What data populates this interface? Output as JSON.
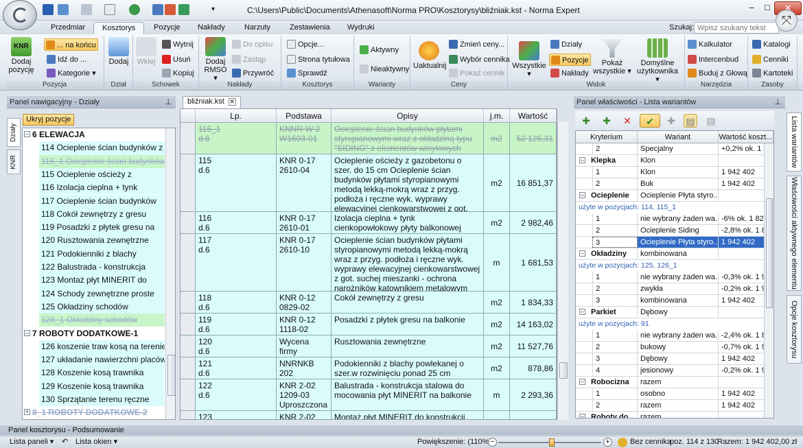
{
  "window": {
    "title": "C:\\Users\\Public\\Documents\\Athenasoft\\Norma PRO\\Kosztorysy\\bliźniak.kst - Norma Expert",
    "minimize": "–",
    "maximize": "□",
    "close": "✕"
  },
  "tabs": [
    "Przedmiar",
    "Kosztorys",
    "Pozycje",
    "Nakłady",
    "Narzuty",
    "Zestawienia",
    "Wydruki"
  ],
  "active_tab": "Kosztorys",
  "search": {
    "label": "Szukaj:",
    "placeholder": "Wpisz szukany tekst"
  },
  "ribbon": {
    "groups": [
      "Pozycja",
      "Dział",
      "Schowek",
      "Nakłady",
      "Kosztorys",
      "Warianty",
      "Ceny",
      "Widok",
      "Narzędzia",
      "Zasoby"
    ],
    "add_position": "Dodaj pozycję",
    "at_end": "... na końcu",
    "go_to": "Idź do ...",
    "categories": "Kategorie",
    "add": "Dodaj",
    "paste": "Wklej",
    "cut": "Wytnij",
    "delete": "Usuń",
    "copy": "Kopiuj",
    "add_rmso": "Dodaj RMSO",
    "to_opis": "Do opisu",
    "replace": "Zastąp",
    "recalc": "Przywróć",
    "options": "Opcje...",
    "title_page": "Strona tytułowa",
    "check": "Sprawdź",
    "active": "Aktywny",
    "inactive": "Nieaktywny",
    "update": "Uaktualnij",
    "change_prices": "Zmień ceny...",
    "choose_pricelist": "Wybór cennika",
    "show_pricelist": "Pokaż cennik",
    "all": "Wszystkie",
    "sections": "Działy",
    "positions": "Pozycje",
    "outlays": "Nakłady",
    "show_all": "Pokaż wszystkie",
    "user_default": "Domyślne użytkownika",
    "calculator": "Kalkulator",
    "intercenbud": "Intercenbud",
    "build_from_glowa": "Buduj z Głową",
    "catalogs": "Katalogi",
    "pricelists": "Cenniki",
    "cards": "Kartoteki"
  },
  "left_panel": {
    "title": "Panel nawigacyjny - Działy",
    "hide_button": "Ukryj pozycje",
    "vtabs": [
      "Działy",
      "KNR"
    ],
    "rows": [
      {
        "type": "hdr",
        "text": "6 ELEWACJA",
        "exp": "–"
      },
      {
        "type": "leaf",
        "text": "114 Ocieplenie ścian budynków z"
      },
      {
        "type": "strike",
        "text": "115_1 Ocieplenie ścian budynków"
      },
      {
        "type": "leaf",
        "text": "115 Ocieplenie ościeży z"
      },
      {
        "type": "leaf",
        "text": "116 Izolacja cieplna + tynk"
      },
      {
        "type": "leaf",
        "text": "117 Ocieplenie ścian budynków"
      },
      {
        "type": "leaf",
        "text": "118 Cokół zewnętrzy z gresu"
      },
      {
        "type": "leaf",
        "text": "119 Posadzki z płytek gresu na"
      },
      {
        "type": "leaf",
        "text": "120 Rusztowania zewnętrzne"
      },
      {
        "type": "leaf",
        "text": "121 Podokienniki z blachy"
      },
      {
        "type": "leaf",
        "text": "122 Balustrada - konstrukcja"
      },
      {
        "type": "leaf",
        "text": "123 Montaż płyt MINERIT do"
      },
      {
        "type": "leaf",
        "text": "124 Schody zewnętrzne proste"
      },
      {
        "type": "leaf",
        "text": "125 Okładziny schodów"
      },
      {
        "type": "strike",
        "text": "126_1 Okładziny schodów"
      },
      {
        "type": "hdr",
        "text": "7 ROBOTY DODATKOWE-1",
        "exp": "–"
      },
      {
        "type": "leaf",
        "text": "126 koszenie traw kosą na terenie"
      },
      {
        "type": "leaf",
        "text": "127 układanie nawierzchni placów"
      },
      {
        "type": "leaf",
        "text": "128 Koszenie kosą trawnika"
      },
      {
        "type": "leaf",
        "text": "129 Koszenie kosą trawnika"
      },
      {
        "type": "leaf",
        "text": "130 Sprzątanie terenu ręczne"
      },
      {
        "type": "strikebold",
        "text": "8_1 ROBOTY DODATKOWE-2",
        "exp": "+"
      }
    ]
  },
  "document": {
    "tab": "bliźniak.kst",
    "columns": [
      "Lp.",
      "Podstawa",
      "Opisy",
      "j.m.",
      "Wartość"
    ],
    "rows": [
      {
        "lp": "115_1\nd.6",
        "base": "KNNR-W 2\nW1603-01",
        "desc": "Ocieplenie ścian budynków płytami styropianowymi wraz z okładziną typu \"SIDING\" z elementów winylowych",
        "unit": "m2",
        "value": "52 126,31",
        "green": true
      },
      {
        "lp": "115\nd.6",
        "base": "KNR 0-17\n2610-04",
        "desc": "Ocieplenie ościeży z gazobetonu o szer. do 15 cm Ocieplenie ścian budynków płytami styropianowymi metodą lekką-mokrą wraz z przyg. podłoża i ręczne wyk. wyprawy elewacyjnej cienkowarstwowej z got. suchej mieszanki",
        "unit": "m2",
        "value": "16 851,37"
      },
      {
        "lp": "116\nd.6",
        "base": "KNR 0-17\n2610-01",
        "desc": "Izolacja cieplna + tynk cienkopowłokowy płyty balkonowej",
        "unit": "m2",
        "value": "2 982,46"
      },
      {
        "lp": "117\nd.6",
        "base": "KNR 0-17\n2610-10",
        "desc": "Ocieplenie ścian budynków płytami styropianowymi metodą lekką-mokrą wraz z przyg. podłoża i ręczne wyk. wyprawy elewacyjnej cienkowarstwowej z got. suchej mieszanki - ochrona narożników kątownikiem metalowym",
        "unit": "m",
        "value": "1 681,53"
      },
      {
        "lp": "118\nd.6",
        "base": "KNR 0-12\n0829-02",
        "desc": "Cokół zewnętrzy z gresu",
        "unit": "m2",
        "value": "1 834,33"
      },
      {
        "lp": "119\nd.6",
        "base": "KNR 0-12\n1118-02",
        "desc": "Posadzki z płytek gresu na balkonie",
        "unit": "m2",
        "value": "14 163,02"
      },
      {
        "lp": "120\nd.6",
        "base": "Wycena\nfirmy",
        "desc": "Rusztowania zewnętrzne",
        "unit": "m2",
        "value": "11 527,76"
      },
      {
        "lp": "121\nd.6",
        "base": "NNRNKB 202\n0541-02",
        "desc": "Podokienniki z blachy powlekanej o szer.w rozwinięciu ponad 25 cm",
        "unit": "m2",
        "value": "878,86"
      },
      {
        "lp": "122\nd.6",
        "base": "KNR 2-02\n1209-03\nUproszczona",
        "desc": "Balustrada - konstrukcja stalowa do mocowania płyt MINERIT na balkonie",
        "unit": "m",
        "value": "2 293,36"
      },
      {
        "lp": "123",
        "base": "KNR 2-02",
        "desc": "Montaż płyt MINERIT do konstrukcji",
        "unit": "",
        "value": ""
      }
    ]
  },
  "right_panel": {
    "title": "Panel właściwości - Lista wariantów",
    "columns": [
      "Kryterium",
      "Wariant",
      "Wartość koszt..."
    ],
    "vtabs": [
      "Lista wariantów",
      "Właściwości aktywnego elementu",
      "Opcje kosztorysu"
    ],
    "rows": [
      {
        "t": "opt",
        "n": "2",
        "v": "Specjalny",
        "w": "+0,2% ok. 1 ..."
      },
      {
        "t": "crit",
        "n": "Klepka",
        "v": "Klon",
        "w": ""
      },
      {
        "t": "opt",
        "n": "1",
        "v": "Klon",
        "w": "1 942 402"
      },
      {
        "t": "opt",
        "n": "2",
        "v": "Buk",
        "w": "1 942 402"
      },
      {
        "t": "crit",
        "n": "Ocieplenie",
        "v": "Ocieplenie Płyta styro...",
        "w": ""
      },
      {
        "t": "used",
        "n": "użyte w pozycjach: 114, 115_1"
      },
      {
        "t": "opt",
        "n": "1",
        "v": "nie wybrany żaden wa...",
        "w": "-6% ok. 1 825..."
      },
      {
        "t": "opt",
        "n": "2",
        "v": "Ocieplenie Siding",
        "w": "-2,8% ok. 1 8..."
      },
      {
        "t": "sel",
        "n": "3",
        "v": "Ocieplenie Płyta styro...",
        "w": "1 942 402"
      },
      {
        "t": "crit",
        "n": "Okładziny",
        "v": "kombinowana",
        "w": ""
      },
      {
        "t": "used",
        "n": "użyte w pozycjach: 125, 126_1"
      },
      {
        "t": "opt",
        "n": "1",
        "v": "nie wybrany żaden wa...",
        "w": "-0,3% ok. 1 9..."
      },
      {
        "t": "opt",
        "n": "2",
        "v": "zwykła",
        "w": "-0,2% ok. 1 9..."
      },
      {
        "t": "opt",
        "n": "3",
        "v": "kombinowana",
        "w": "1 942 402"
      },
      {
        "t": "crit",
        "n": "Parkiet",
        "v": "Dębowy",
        "w": ""
      },
      {
        "t": "used",
        "n": "użyte w pozycjach: 91"
      },
      {
        "t": "opt",
        "n": "1",
        "v": "nie wybrany żaden wa...",
        "w": "-2,4% ok. 1 8..."
      },
      {
        "t": "opt",
        "n": "2",
        "v": "bukowy",
        "w": "-0,7% ok. 1 9..."
      },
      {
        "t": "opt",
        "n": "3",
        "v": "Dębowy",
        "w": "1 942 402"
      },
      {
        "t": "opt",
        "n": "4",
        "v": "jesionowy",
        "w": "-0,2% ok. 1 9..."
      },
      {
        "t": "crit",
        "n": "Robocizna",
        "v": "razem",
        "w": ""
      },
      {
        "t": "opt",
        "n": "1",
        "v": "osobno",
        "w": "1 942 402"
      },
      {
        "t": "opt",
        "n": "2",
        "v": "razem",
        "w": "1 942 402"
      },
      {
        "t": "crit",
        "n": "Roboty do...",
        "v": "razem",
        "w": ""
      }
    ]
  },
  "bottom_panel": {
    "title": "Panel kosztorysu - Podsumowanie"
  },
  "status": {
    "panel_list": "Lista paneli",
    "window_list": "Lista okien",
    "zoom_label": "Powiększenie: (110%)",
    "zoom_percent": 110,
    "pricelist": "Bez cennika",
    "position": "poz. 114 z 130",
    "total": "Razem: 1 942 402,00 zł"
  }
}
